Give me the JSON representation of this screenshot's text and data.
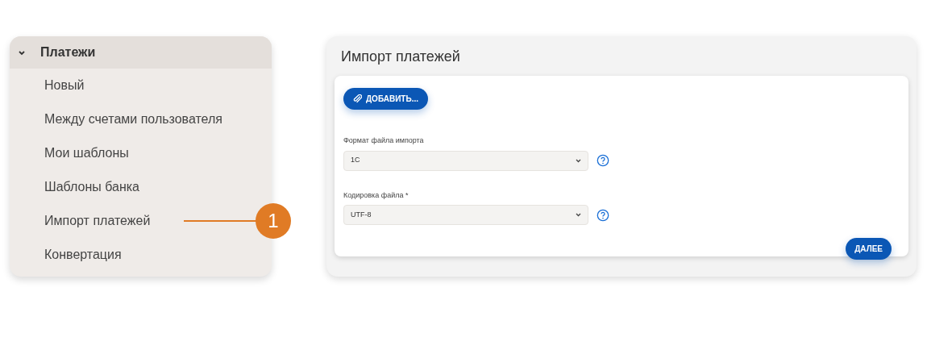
{
  "menu": {
    "group": {
      "label": "Платежи",
      "expanded": true
    },
    "items": [
      {
        "label": "Новый"
      },
      {
        "label": "Между счетами пользователя"
      },
      {
        "label": "Мои шаблоны"
      },
      {
        "label": "Шаблоны банка"
      },
      {
        "label": "Импорт платежей",
        "callout": "1"
      },
      {
        "label": "Конвертация"
      }
    ]
  },
  "panel": {
    "title": "Импорт платежей",
    "add_button": "ДОБАВИТЬ...",
    "fields": [
      {
        "label": "Формат файла импорта",
        "value": "1C"
      },
      {
        "label": "Кодировка файла *",
        "value": "UTF-8"
      }
    ],
    "next_button": "ДАЛЕЕ"
  }
}
